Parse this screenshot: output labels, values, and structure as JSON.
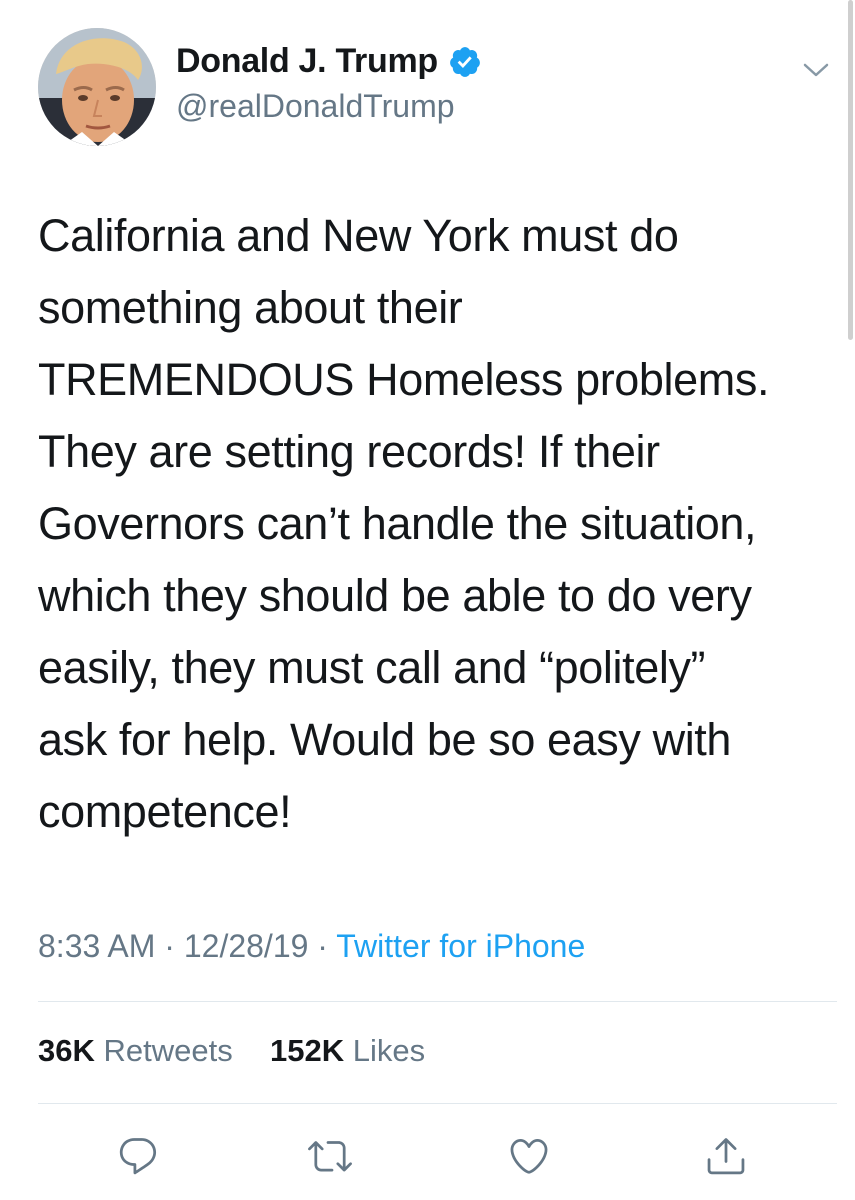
{
  "tweet": {
    "author": {
      "display_name": "Donald J. Trump",
      "handle": "@realDonaldTrump",
      "verified": true
    },
    "text": "California and New York must do\nsomething about their\nTREMENDOUS Homeless problems.\nThey are setting records! If their\nGovernors can’t handle the situation,\nwhich they should be able to do very\neasily, they must call and “politely”\nask for help. Would be so easy with\ncompetence!",
    "meta": {
      "time": "8:33 AM",
      "date": "12/28/19",
      "separator": "·",
      "source": "Twitter for iPhone"
    },
    "stats": {
      "retweets_count": "36K",
      "retweets_label": "Retweets",
      "likes_count": "152K",
      "likes_label": "Likes"
    }
  },
  "icons": {
    "verified": "verified-badge-icon",
    "more": "chevron-down-icon",
    "reply": "reply-icon",
    "retweet": "retweet-icon",
    "like": "heart-icon",
    "share": "share-icon"
  },
  "colors": {
    "text_primary": "#14171a",
    "text_secondary": "#657786",
    "accent": "#1da1f2",
    "divider": "#e1e8ed"
  }
}
